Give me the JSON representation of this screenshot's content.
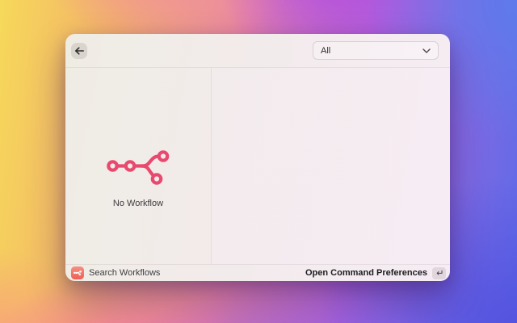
{
  "header": {
    "dropdown_value": "All"
  },
  "left_panel": {
    "empty_label": "No Workflow"
  },
  "footer": {
    "command_label": "Search Workflows",
    "action_label": "Open Command Preferences"
  },
  "icons": {
    "back": "arrow-left",
    "dropdown": "chevron-down",
    "workflow": "flow-branch",
    "footer_app": "flow-branch-badge",
    "action_key": "return-enter"
  },
  "colors": {
    "accent_pink": "#e9486f",
    "footer_icon_bg": "#ee5f55",
    "window_bg_left": "#efece4",
    "window_bg_right": "#f6ecf4",
    "background_corners": {
      "top_left": "#f6d95a",
      "top_right": "#5c7cec",
      "bottom_left": "#f9997f",
      "bottom_right": "#5453e0"
    }
  }
}
